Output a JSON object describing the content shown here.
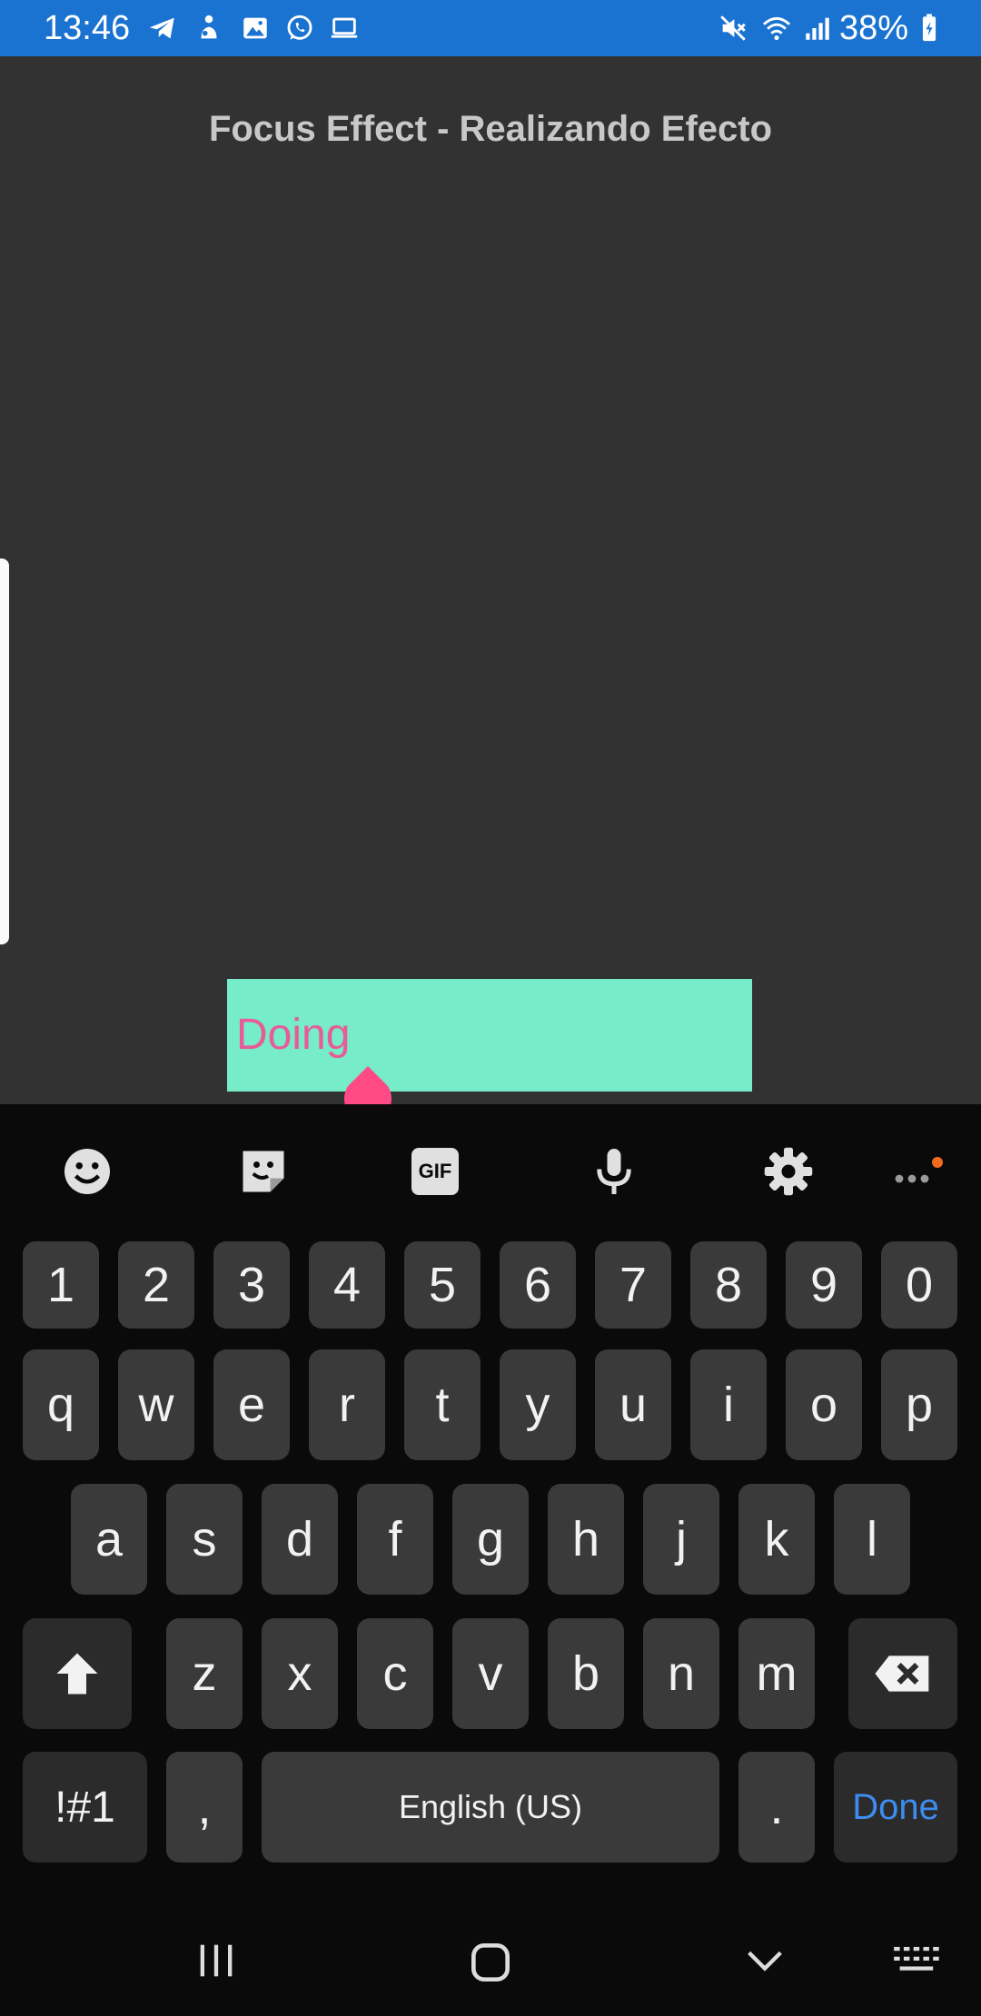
{
  "status_bar": {
    "time": "13:46",
    "battery": "38%",
    "left_icons": [
      "telegram-icon",
      "person-activity-icon",
      "gallery-icon",
      "whatsapp-icon",
      "laptop-icon"
    ],
    "right_icons": [
      "mute-icon",
      "wifi-icon",
      "signal-icon",
      "battery-icon"
    ],
    "color": "#1a73d1"
  },
  "app": {
    "title": "Focus Effect - Realizando Efecto",
    "text_field_value": "Doing",
    "field_color": "#76ecc8",
    "text_color": "#e85b98",
    "handle_color": "#ff4a86"
  },
  "keyboard": {
    "toolbar": [
      "emoji-icon",
      "sticker-icon",
      "gif-icon",
      "microphone-icon",
      "settings-icon",
      "more-icon"
    ],
    "gif_label": "GIF",
    "rows": [
      [
        "1",
        "2",
        "3",
        "4",
        "5",
        "6",
        "7",
        "8",
        "9",
        "0"
      ],
      [
        "q",
        "w",
        "e",
        "r",
        "t",
        "y",
        "u",
        "i",
        "o",
        "p"
      ],
      [
        "a",
        "s",
        "d",
        "f",
        "g",
        "h",
        "j",
        "k",
        "l"
      ],
      [
        "z",
        "x",
        "c",
        "v",
        "b",
        "n",
        "m"
      ]
    ],
    "symbols_label": "!#1",
    "comma_label": ",",
    "space_label": "English (US)",
    "period_label": ".",
    "done_label": "Done"
  },
  "nav_bar": {
    "items": [
      "recent-apps-icon",
      "home-icon",
      "back-icon",
      "keyboard-switch-icon"
    ]
  }
}
